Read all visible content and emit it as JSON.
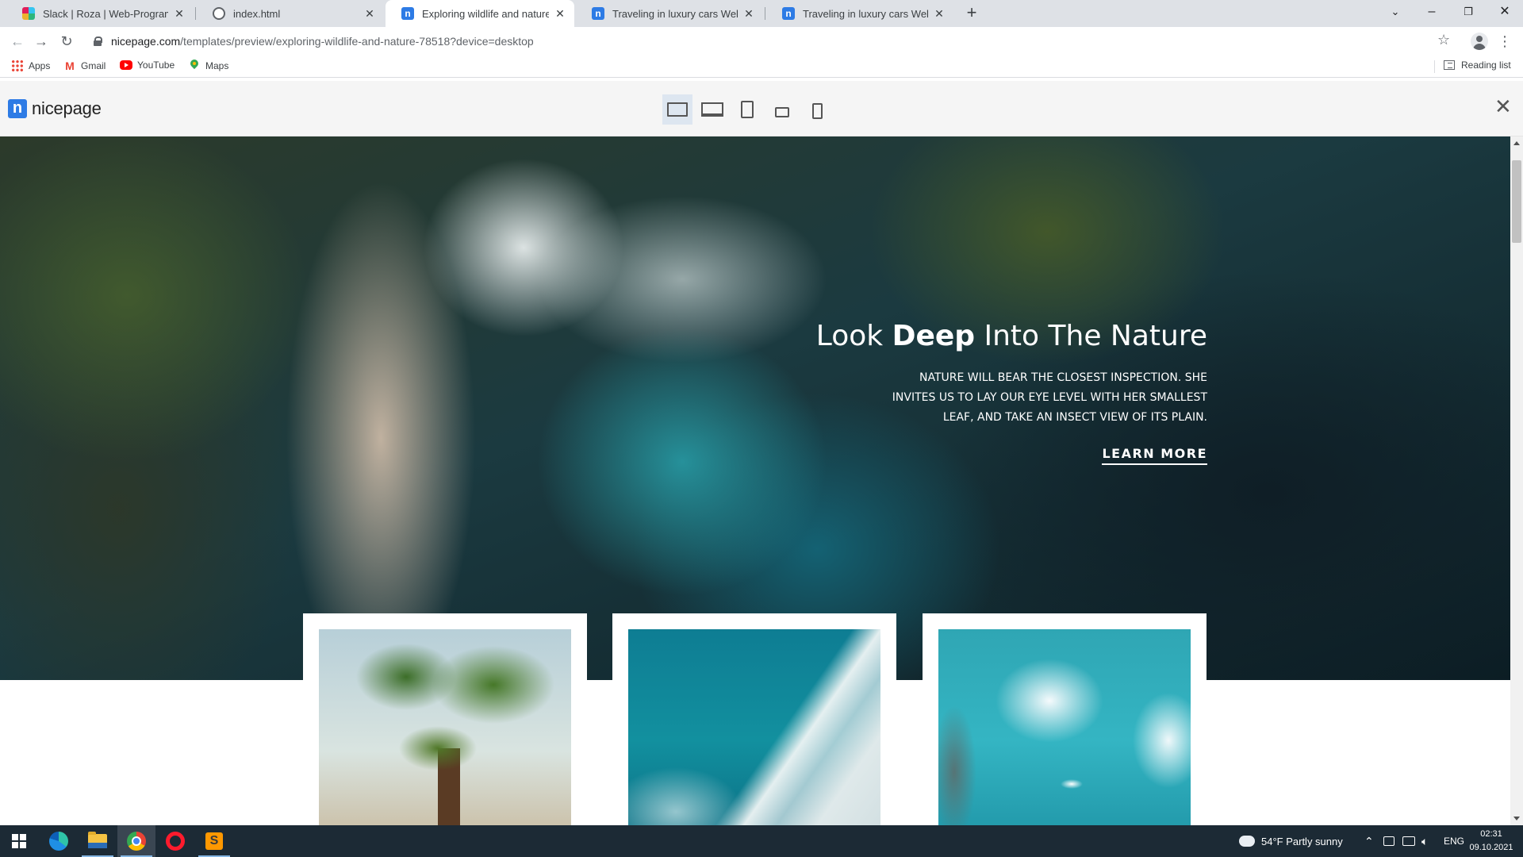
{
  "browser": {
    "tabs": [
      {
        "title": "Slack | Roza | Web-Programming",
        "favicon": "slack-icon",
        "active": false
      },
      {
        "title": "index.html",
        "favicon": "globe-icon",
        "active": false
      },
      {
        "title": "Exploring wildlife and nature Ter",
        "favicon": "nicepage-icon",
        "active": true
      },
      {
        "title": "Traveling in luxury cars Web Page",
        "favicon": "nicepage-icon",
        "active": false
      },
      {
        "title": "Traveling in luxury cars Web Page",
        "favicon": "nicepage-icon",
        "active": false
      }
    ],
    "url": {
      "host": "nicepage.com",
      "path": "/templates/preview/exploring-wildlife-and-nature-78518?device=desktop"
    },
    "bookmarks": [
      {
        "label": "Apps",
        "icon": "apps-icon"
      },
      {
        "label": "Gmail",
        "icon": "gmail-icon"
      },
      {
        "label": "YouTube",
        "icon": "youtube-icon"
      },
      {
        "label": "Maps",
        "icon": "maps-icon"
      }
    ],
    "reading_list": "Reading list"
  },
  "preview": {
    "logo_text": "nicepage",
    "devices": [
      "desktop-icon",
      "laptop-icon",
      "tablet-icon",
      "tablet-landscape-icon",
      "phone-icon"
    ],
    "active_device": "desktop"
  },
  "hero": {
    "title_pre": "Look ",
    "title_bold": "Deep",
    "title_post": " Into The Nature",
    "desc_lines": [
      "NATURE WILL BEAR THE CLOSEST INSPECTION. SHE",
      "INVITES US TO LAY OUR EYE LEVEL WITH HER SMALLEST",
      "LEAF, AND TAKE AN INSECT VIEW OF ITS PLAIN."
    ],
    "cta": "LEARN MORE"
  },
  "cards": [
    {
      "image": "baobab tree"
    },
    {
      "image": "ocean wave aerial"
    },
    {
      "image": "iceberg with boat"
    }
  ],
  "taskbar": {
    "weather": "54°F  Partly sunny",
    "lang": "ENG",
    "time": "02:31",
    "date": "09.10.2021"
  },
  "colors": {
    "accent": "#2d7be5",
    "taskbar": "#1c2a35",
    "tabstrip": "#dee1e6"
  }
}
